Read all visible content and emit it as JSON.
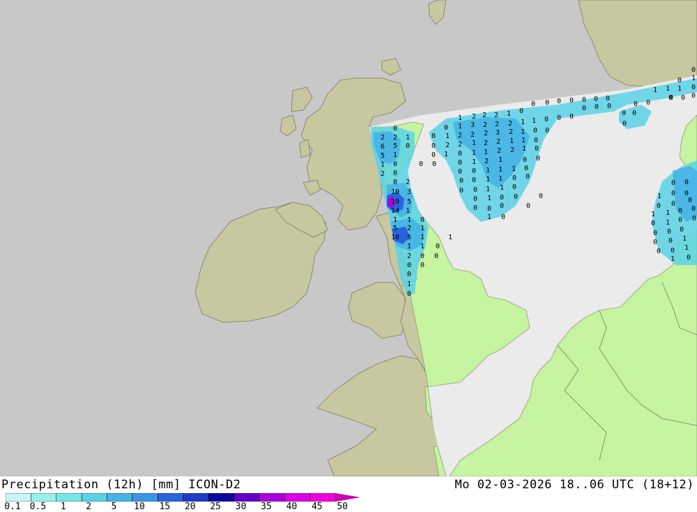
{
  "title": "Precipitation (12h) [mm] ICON-D2",
  "datetime": "Mo 02-03-2026 18..06 UTC (18+12)",
  "legend": {
    "ticks": [
      "0.1",
      "0.5",
      "1",
      "2",
      "5",
      "10",
      "15",
      "20",
      "25",
      "30",
      "35",
      "40",
      "45",
      "50"
    ],
    "colors": [
      "#c8f5f5",
      "#96f0f0",
      "#78e6e6",
      "#5ad2e6",
      "#46b4e6",
      "#3c96e6",
      "#2864dc",
      "#1e3cc8",
      "#0a0aa0",
      "#6400c8",
      "#aa00dc",
      "#dc00e6",
      "#f000dc",
      "#c800b4"
    ]
  },
  "map_colors": {
    "sea_outside": "#c8c8c8",
    "land_outside": "#c8c8a0",
    "sea_domain": "#ebebeb",
    "land_domain": "#c6f4a0",
    "border": "#787864"
  },
  "values": [
    "0",
    "1",
    "2",
    "2",
    "2",
    "1",
    "0",
    "0",
    "0",
    "0",
    "0",
    "0",
    "0",
    "0",
    "1",
    "1",
    "1",
    "1",
    "0",
    "0",
    "1",
    "3",
    "2",
    "2",
    "2",
    "1",
    "1",
    "0",
    "0",
    "0",
    "0",
    "0",
    "0",
    "0",
    "0",
    "0",
    "2",
    "2",
    "1",
    "0",
    "1",
    "2",
    "2",
    "2",
    "3",
    "2",
    "1",
    "0",
    "0",
    "0",
    "6",
    "5",
    "0",
    "0",
    "2",
    "2",
    "1",
    "2",
    "2",
    "1",
    "1",
    "0",
    "5",
    "1",
    "0",
    "1",
    "0",
    "1",
    "1",
    "2",
    "2",
    "1",
    "0",
    "1",
    "0",
    "0",
    "0",
    "0",
    "1",
    "2",
    "1",
    "0",
    "0",
    "2",
    "0",
    "0",
    "0",
    "1",
    "1",
    "1",
    "0",
    "0",
    "2",
    "0",
    "0",
    "1",
    "1",
    "0",
    "0",
    "10",
    "3",
    "0",
    "0",
    "1",
    "1",
    "0",
    "0",
    "19",
    "5",
    "0",
    "1",
    "0",
    "0",
    "0",
    "0",
    "14",
    "1",
    "0",
    "1",
    "0",
    "0",
    "1",
    "1",
    "0",
    "0",
    "0",
    "5",
    "2",
    "1",
    "10",
    "5",
    "1",
    "1",
    "1",
    "1",
    "0",
    "2",
    "0",
    "0",
    "0",
    "1",
    "0",
    "0",
    "0",
    "0",
    "0",
    "1",
    "0",
    "0",
    "0",
    "0",
    "0",
    "1",
    "1",
    "0",
    "0",
    "0",
    "1",
    "0",
    "0",
    "0",
    "0",
    "0",
    "0",
    "0",
    "1",
    "0",
    "0",
    "1",
    "1",
    "0",
    "0",
    "0",
    "0",
    "0",
    "0"
  ]
}
